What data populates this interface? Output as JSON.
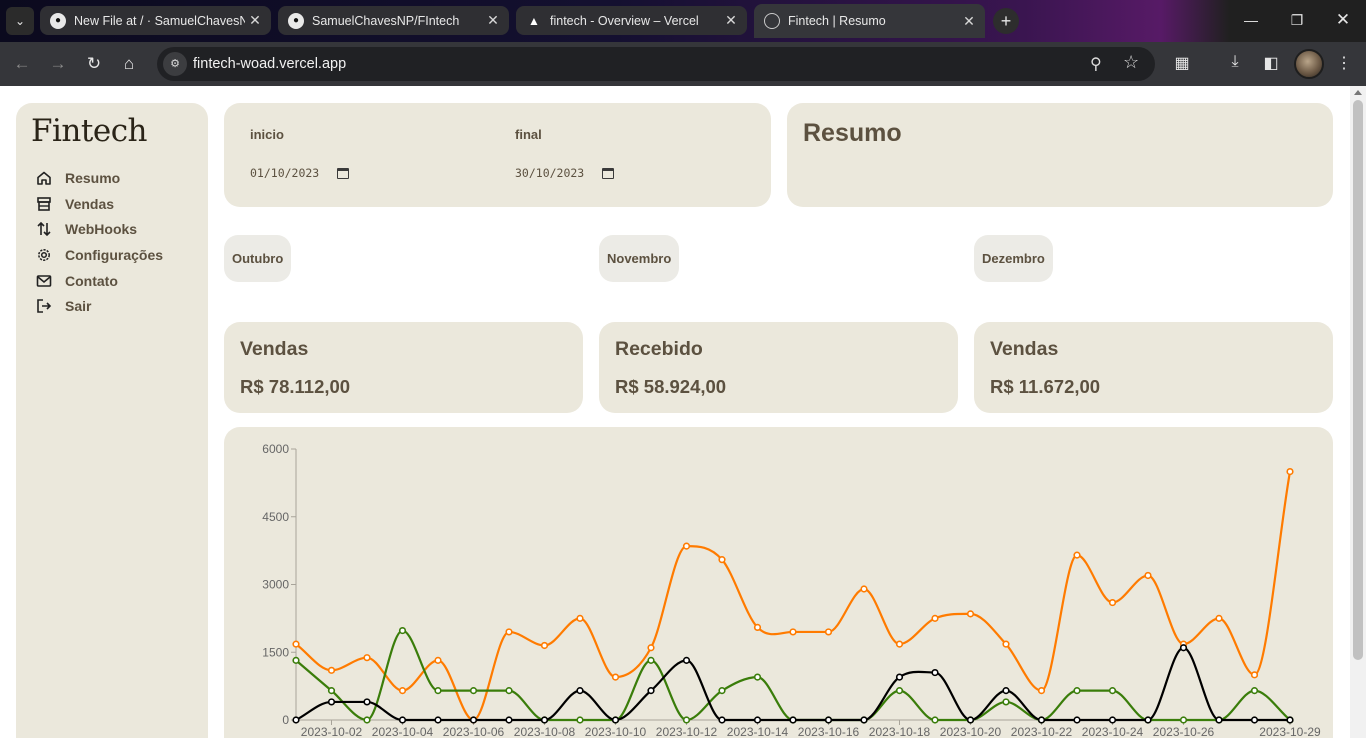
{
  "browser": {
    "tabs": [
      {
        "title": "New File at / · SamuelChavesNP",
        "icon": "github-icon"
      },
      {
        "title": "SamuelChavesNP/FIntech",
        "icon": "github-icon"
      },
      {
        "title": "fintech - Overview – Vercel",
        "icon": "vercel-icon"
      },
      {
        "title": "Fintech | Resumo",
        "icon": "globe-icon"
      }
    ],
    "url": "fintech-woad.vercel.app"
  },
  "sidebar": {
    "logo": "Fintech",
    "items": [
      {
        "label": "Resumo",
        "icon": "home-icon"
      },
      {
        "label": "Vendas",
        "icon": "store-icon"
      },
      {
        "label": "WebHooks",
        "icon": "arrows-updown-icon"
      },
      {
        "label": "Configurações",
        "icon": "gear-icon"
      },
      {
        "label": "Contato",
        "icon": "mail-icon"
      },
      {
        "label": "Sair",
        "icon": "logout-icon"
      }
    ]
  },
  "dates": {
    "start_label": "inicio",
    "start_value": "01/10/2023",
    "end_label": "final",
    "end_value": "30/10/2023"
  },
  "header": {
    "title": "Resumo"
  },
  "months": [
    "Outubro",
    "Novembro",
    "Dezembro"
  ],
  "stats": [
    {
      "title": "Vendas",
      "value": "R$ 78.112,00"
    },
    {
      "title": "Recebido",
      "value": "R$ 58.924,00"
    },
    {
      "title": "Vendas",
      "value": "R$ 11.672,00"
    }
  ],
  "colors": {
    "orange": "#ff7b00",
    "green": "#3a7d0a",
    "black": "#000000",
    "card": "#ebe8dc",
    "text": "#5c5140"
  },
  "chart_data": {
    "type": "line",
    "title": "",
    "xlabel": "",
    "ylabel": "",
    "ylim": [
      0,
      6000
    ],
    "yticks": [
      0,
      1500,
      3000,
      4500,
      6000
    ],
    "xtick_labels": [
      "2023-10-02",
      "2023-10-04",
      "2023-10-06",
      "2023-10-08",
      "2023-10-10",
      "2023-10-12",
      "2023-10-14",
      "2023-10-16",
      "2023-10-18",
      "2023-10-20",
      "2023-10-22",
      "2023-10-24",
      "2023-10-26",
      "2023-10-29"
    ],
    "x": [
      "2023-10-01",
      "2023-10-02",
      "2023-10-03",
      "2023-10-04",
      "2023-10-05",
      "2023-10-06",
      "2023-10-07",
      "2023-10-08",
      "2023-10-09",
      "2023-10-10",
      "2023-10-11",
      "2023-10-12",
      "2023-10-13",
      "2023-10-14",
      "2023-10-15",
      "2023-10-16",
      "2023-10-17",
      "2023-10-18",
      "2023-10-19",
      "2023-10-20",
      "2023-10-21",
      "2023-10-22",
      "2023-10-23",
      "2023-10-24",
      "2023-10-25",
      "2023-10-26",
      "2023-10-27",
      "2023-10-28",
      "2023-10-29"
    ],
    "series": [
      {
        "color": "#ff7b00",
        "values": [
          1680,
          1100,
          1380,
          650,
          1320,
          0,
          1950,
          1650,
          2250,
          950,
          1600,
          3850,
          3550,
          2050,
          1950,
          1950,
          2900,
          1680,
          2250,
          2350,
          1680,
          650,
          3650,
          2600,
          3200,
          1680,
          2250,
          1000,
          5500
        ]
      },
      {
        "color": "#3a7d0a",
        "values": [
          1320,
          650,
          0,
          1980,
          650,
          650,
          650,
          0,
          0,
          0,
          1320,
          0,
          650,
          950,
          0,
          0,
          0,
          650,
          0,
          0,
          400,
          0,
          650,
          650,
          0,
          0,
          0,
          650,
          0
        ]
      },
      {
        "color": "#000000",
        "values": [
          0,
          400,
          400,
          0,
          0,
          0,
          0,
          0,
          650,
          0,
          650,
          1320,
          0,
          0,
          0,
          0,
          0,
          950,
          1050,
          0,
          650,
          0,
          0,
          0,
          0,
          1600,
          0,
          0,
          0
        ]
      }
    ]
  }
}
